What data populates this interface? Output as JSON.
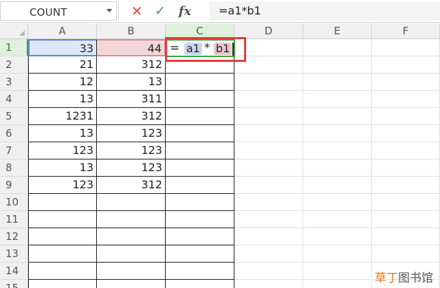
{
  "formula_bar": {
    "name_box_value": "COUNT",
    "cancel_symbol": "✕",
    "enter_symbol": "✓",
    "fx_label": "fx",
    "formula_value": "=a1*b1"
  },
  "columns": [
    "A",
    "B",
    "C",
    "D",
    "E",
    "F"
  ],
  "rows": [
    "1",
    "2",
    "3",
    "4",
    "5",
    "6",
    "7",
    "8",
    "9",
    "10",
    "11",
    "12",
    "13",
    "14",
    "15"
  ],
  "cells": {
    "A": [
      "33",
      "21",
      "12",
      "13",
      "1231",
      "13",
      "123",
      "13",
      "123"
    ],
    "B": [
      "44",
      "312",
      "13",
      "311",
      "312",
      "123",
      "123",
      "123",
      "312"
    ]
  },
  "active_cell_edit": {
    "equals": "=",
    "ref_a": "a1",
    "operator": "*",
    "ref_b": "b1"
  },
  "watermark": {
    "part1": "草丁",
    "part2": "图书馆"
  },
  "colors": {
    "active_green": "#37a33f",
    "ref_a_blue": "#5b84cf",
    "ref_b_red": "#d98b91",
    "highlight_red": "#e33b3b"
  }
}
